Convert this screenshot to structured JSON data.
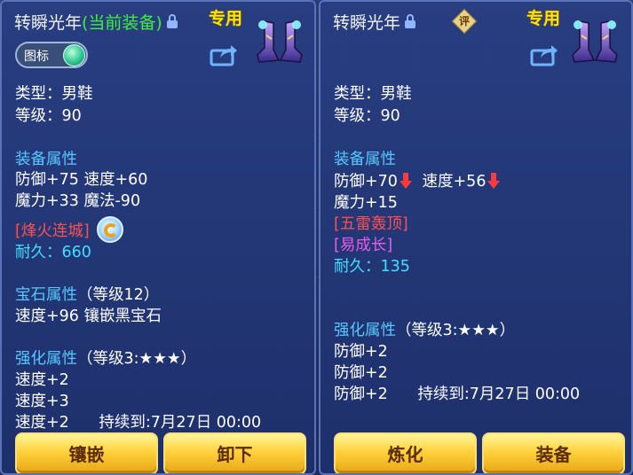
{
  "left_panel": {
    "title": "转瞬光年",
    "title_note": "(当前装备)",
    "special_tag": "专用",
    "toggle_label": "图标",
    "type_line": "类型：男鞋",
    "level_line": "等级：90",
    "equip_attr_header": "装备属性",
    "attr_line_1": "防御+75 速度+60",
    "attr_line_2": "魔力+33 魔法-90",
    "special_skill": "[烽火连城]",
    "durability": "耐久：660",
    "gem_header": "宝石属性",
    "gem_level": "（等级12）",
    "gem_line": "速度+96 镶嵌黑宝石",
    "enhance_header": "强化属性",
    "enhance_level": "（等级3:★★★）",
    "enhance_line_1": "速度+2",
    "enhance_line_2": "速度+3",
    "enhance_line_3": "速度+2",
    "enhance_expiry": "持续到:7月27日 00:00",
    "buttons": {
      "inlay": "镶嵌",
      "remove": "卸下"
    }
  },
  "right_panel": {
    "title": "转瞬光年",
    "rate_badge": "评",
    "special_tag": "专用",
    "type_line": "类型：男鞋",
    "level_line": "等级：90",
    "equip_attr_header": "装备属性",
    "attr_defense": "防御+70",
    "attr_speed": "速度+56",
    "attr_magic": "魔力+15",
    "special_effect_1": "[五雷轰顶]",
    "special_effect_2": "[易成长]",
    "durability": "耐久：135",
    "enhance_header": "强化属性",
    "enhance_level": "（等级3:★★★）",
    "enhance_line_1": "防御+2",
    "enhance_line_2": "防御+2",
    "enhance_line_3": "防御+2",
    "enhance_expiry": "持续到:7月27日 00:00",
    "buttons": {
      "refine": "炼化",
      "equip": "装备"
    }
  },
  "colors": {
    "section_blue": "#57c8ff",
    "current_green": "#3cf03c",
    "special_yellow": "#ffe600",
    "effect_red": "#ff5050",
    "effect_pink": "#e85ce8",
    "durability_cyan": "#3fe0ff",
    "button_gold": "#ffd23c"
  },
  "icons": [
    "lock-icon",
    "boots-item-icon",
    "share-icon",
    "toggle-switch",
    "skill-icon",
    "down-arrow-icon",
    "rate-badge-icon"
  ]
}
